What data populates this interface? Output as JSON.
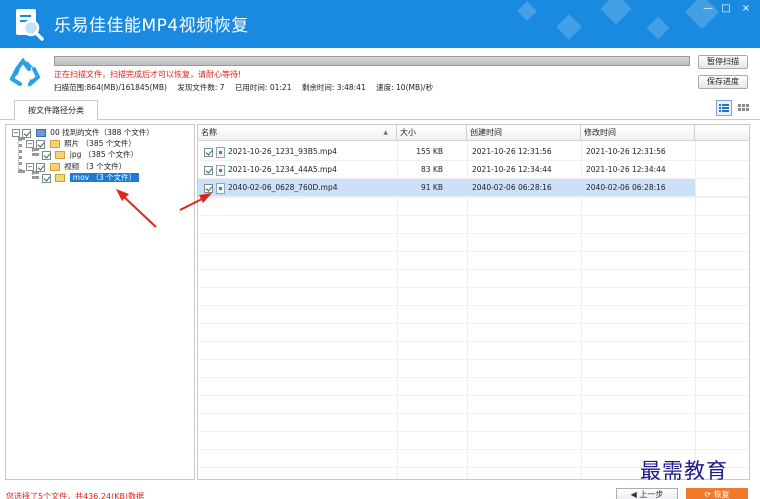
{
  "app": {
    "title": "乐易佳佳能MP4视频恢复",
    "min_glyph": "—",
    "max_glyph": "□",
    "close_glyph": "×"
  },
  "scan": {
    "progress": 1.0,
    "warning": "正在扫描文件，扫描完成后才可以恢复，请耐心等待!",
    "range_label": "扫描范围:",
    "range_value": "864(MB)/161845(MB)",
    "found_label": "发现文件数:",
    "found_value": "7",
    "elapsed_label": "已用时间:",
    "elapsed_value": "01:21",
    "remaining_label": "剩余时间:",
    "remaining_value": "3:48:41",
    "speed_label": "速度:",
    "speed_value": "10(MB)/秒",
    "pause_label": "暂停扫描",
    "save_label": "保存进度"
  },
  "tabs": {
    "active": "按文件路径分类"
  },
  "tree": {
    "root": "00 找到的文件（388 个文件）",
    "pictures": "照片 （385 个文件）",
    "jpg": "jpg （385 个文件）",
    "video": "视频 （3 个文件）",
    "mov": "mov （3 个文件）"
  },
  "list": {
    "columns": [
      "名称",
      "大小",
      "创建时间",
      "修改时间"
    ],
    "rows": [
      {
        "name": "2021-10-26_1231_93B5.mp4",
        "size": "155 KB",
        "created": "2021-10-26 12:31:56",
        "modified": "2021-10-26 12:31:56",
        "checked": true,
        "selected": false
      },
      {
        "name": "2021-10-26_1234_44A5.mp4",
        "size": "83 KB",
        "created": "2021-10-26 12:34:44",
        "modified": "2021-10-26 12:34:44",
        "checked": true,
        "selected": false
      },
      {
        "name": "2040-02-06_0628_760D.mp4",
        "size": "91 KB",
        "created": "2040-02-06 06:28:16",
        "modified": "2040-02-06 06:28:16",
        "checked": true,
        "selected": true
      }
    ]
  },
  "footer": {
    "status": "您选择了5个文件，共436.24(KB)数据",
    "prev_label": "◀ 上一步",
    "recover_label": "⟳ 恢复"
  },
  "watermark": "最需教育",
  "colors": {
    "titlebar": "#1a8ae0",
    "warning": "#e0231c",
    "selection": "#1e78d6",
    "recover_button": "#f07a2a"
  },
  "icons": {
    "app_logo": "magnifier-document-icon",
    "scan_status": "recycle-icon",
    "list_view": "list-view-icon",
    "grid_view": "grid-view-icon"
  }
}
